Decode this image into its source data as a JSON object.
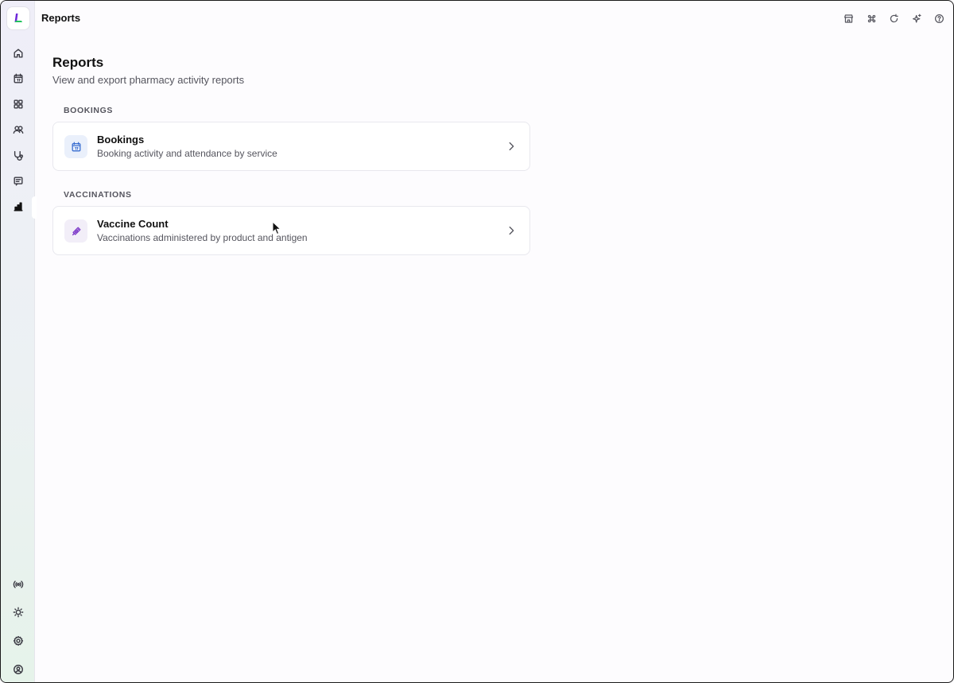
{
  "header": {
    "title": "Reports"
  },
  "main": {
    "title": "Reports",
    "subtitle": "View and export pharmacy activity reports",
    "sections": [
      {
        "label": "BOOKINGS",
        "cards": [
          {
            "title": "Bookings",
            "description": "Booking activity and attendance by service",
            "icon": "calendar-icon"
          }
        ]
      },
      {
        "label": "VACCINATIONS",
        "cards": [
          {
            "title": "Vaccine Count",
            "description": "Vaccinations administered by product and antigen",
            "icon": "syringe-icon"
          }
        ]
      }
    ]
  },
  "sidebar": {
    "top_items": [
      "home-icon",
      "calendar-icon",
      "grid-icon",
      "users-icon",
      "stethoscope-icon",
      "message-icon",
      "bar-chart-icon"
    ],
    "bottom_items": [
      "broadcast-icon",
      "sun-icon",
      "settings-icon",
      "account-icon"
    ],
    "active": "bar-chart-icon"
  },
  "topbar_icons": [
    "store-icon",
    "command-icon",
    "refresh-icon",
    "sparkle-icon",
    "help-icon"
  ],
  "colors": {
    "logo_purple": "#6d28d9",
    "logo_green": "#22c55e",
    "calendar_blue": "#3b6fd1",
    "syringe_purple": "#7e3bc9"
  }
}
